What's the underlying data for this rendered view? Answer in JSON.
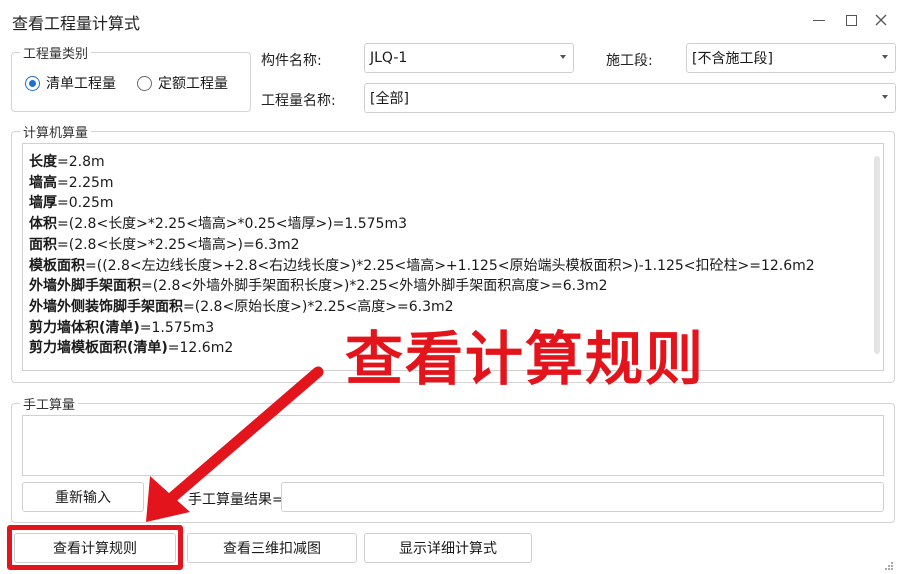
{
  "window": {
    "title": "查看工程量计算式"
  },
  "quantity_type": {
    "legend": "工程量类别",
    "options": [
      {
        "label": "清单工程量",
        "selected": true
      },
      {
        "label": "定额工程量",
        "selected": false
      }
    ]
  },
  "filters": {
    "component_label": "构件名称:",
    "component_value": "JLQ-1",
    "stage_label": "施工段:",
    "stage_value": "[不含施工段]",
    "quantity_name_label": "工程量名称:",
    "quantity_name_value": "[全部]"
  },
  "computer_calc": {
    "legend": "计算机算量",
    "lines": [
      {
        "name": "长度",
        "expr": "=2.8m"
      },
      {
        "name": "墙高",
        "expr": "=2.25m"
      },
      {
        "name": "墙厚",
        "expr": "=0.25m"
      },
      {
        "name": "体积",
        "expr": "=(2.8<长度>*2.25<墙高>*0.25<墙厚>)=1.575m3"
      },
      {
        "name": "面积",
        "expr": "=(2.8<长度>*2.25<墙高>)=6.3m2"
      },
      {
        "name": "模板面积",
        "expr": "=((2.8<左边线长度>+2.8<右边线长度>)*2.25<墙高>+1.125<原始端头模板面积>)-1.125<扣砼柱>=12.6m2"
      },
      {
        "name": "外墙外脚手架面积",
        "expr": "=(2.8<外墙外脚手架面积长度>)*2.25<外墙外脚手架面积高度>=6.3m2"
      },
      {
        "name": "外墙外侧装饰脚手架面积",
        "expr": "=(2.8<原始长度>)*2.25<高度>=6.3m2"
      },
      {
        "name": "剪力墙体积(清单)",
        "expr": "=1.575m3"
      },
      {
        "name": "剪力墙模板面积(清单)",
        "expr": "=12.6m2"
      }
    ]
  },
  "manual_calc": {
    "legend": "手工算量",
    "reenter_button": "重新输入",
    "result_label": "手工算量结果="
  },
  "buttons": {
    "view_rules": "查看计算规则",
    "view_3d": "查看三维扣减图",
    "show_detail": "显示详细计算式"
  },
  "annotation": {
    "text": "查看计算规则",
    "color": "#e3141b"
  }
}
